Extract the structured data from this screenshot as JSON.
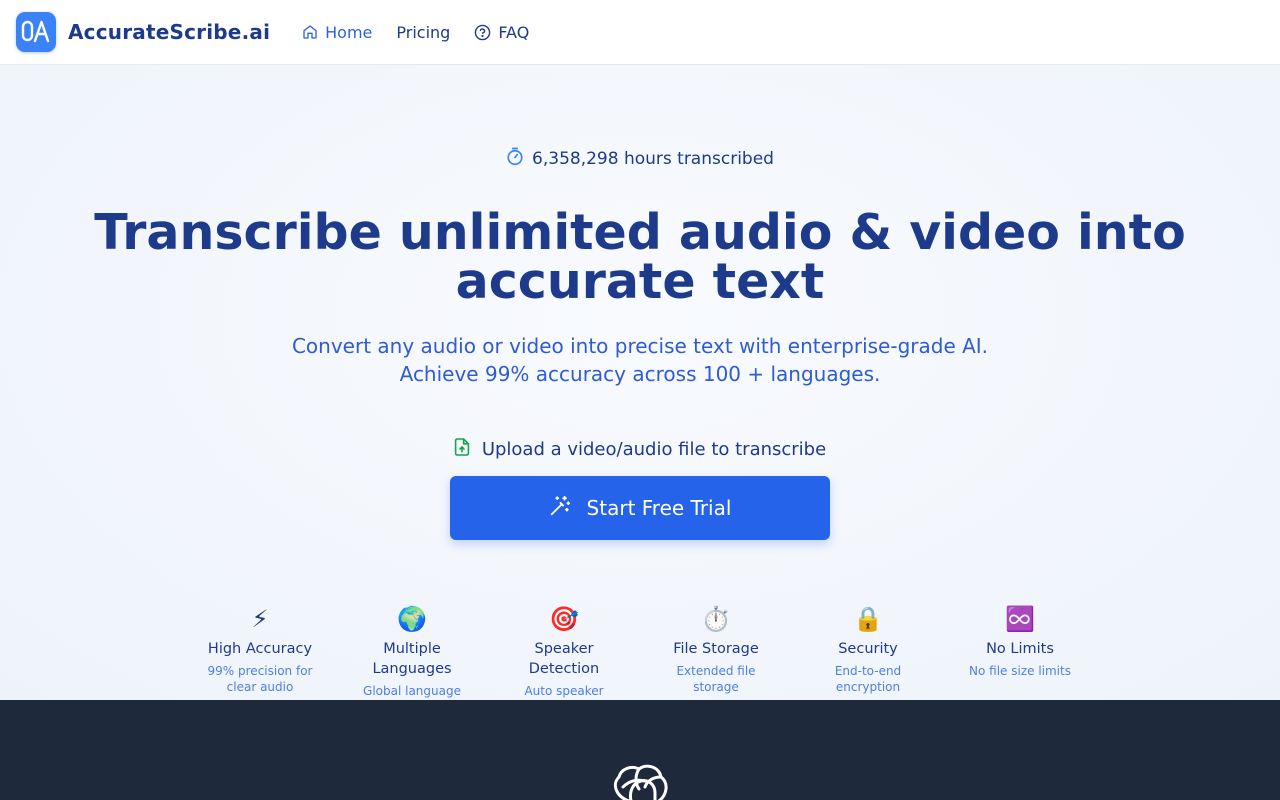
{
  "header": {
    "brand": "AccurateScribe.ai",
    "nav": [
      {
        "label": "Home",
        "icon": "home-icon",
        "active": true
      },
      {
        "label": "Pricing"
      },
      {
        "label": "FAQ",
        "icon": "help-circle-icon"
      }
    ]
  },
  "hero": {
    "stat_text": "6,358,298 hours transcribed",
    "headline_line1": "Transcribe unlimited audio & video into",
    "headline_line2": "accurate text",
    "subline_line1": "Convert any audio or video into precise text with enterprise-grade AI.",
    "subline_line2": "Achieve 99% accuracy across 100 + languages.",
    "upload_text": "Upload a video/audio file to transcribe",
    "cta_label": "Start Free Trial"
  },
  "features": [
    {
      "icon": "⚡",
      "title": "High Accuracy",
      "desc": "99% precision for clear audio"
    },
    {
      "icon": "🌍",
      "title": "Multiple Languages",
      "desc": "Global language support"
    },
    {
      "icon": "🎯",
      "title": "Speaker Detection",
      "desc": "Auto speaker detection"
    },
    {
      "icon": "⏱️",
      "title": "File Storage",
      "desc": "Extended file storage"
    },
    {
      "icon": "🔒",
      "title": "Security",
      "desc": "End-to-end encryption"
    },
    {
      "icon": "♾️",
      "title": "No Limits",
      "desc": "No file size limits"
    }
  ],
  "colors": {
    "primary": "#2563eb",
    "navy": "#1e3a8a",
    "dark_band": "#1e293b"
  }
}
